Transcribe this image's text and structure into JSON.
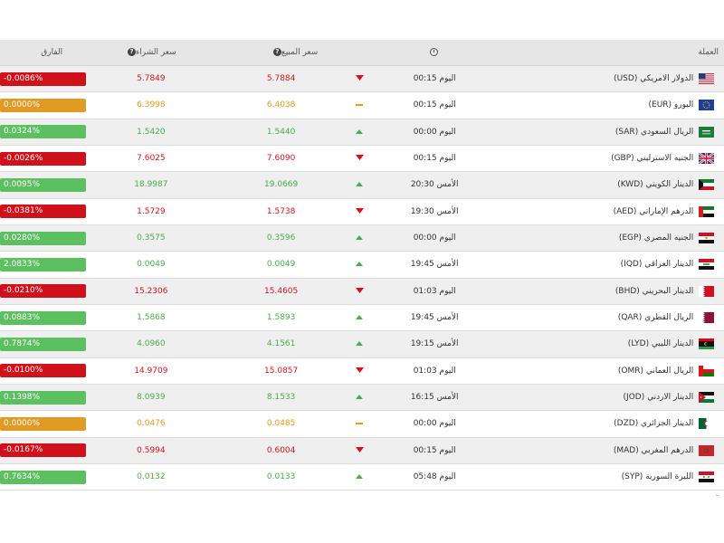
{
  "header": {
    "currency": "العملة",
    "sell_price": "سعر المبيع",
    "buy_price": "سعر الشراء",
    "difference": "الفارق",
    "time_icon": "clock-icon",
    "help_icon": "help-icon"
  },
  "colors": {
    "down": "#d0101a",
    "up": "#5cbf60",
    "flat": "#e19b25",
    "header_bg": "#e6e6e6"
  },
  "rows": [
    {
      "name": "الدولار الامريكي (USD)",
      "flag": "us",
      "time": "اليوم 00:15",
      "trend": "down",
      "sell": "5.7884",
      "buy": "5.7849",
      "diff": "-0.0086%"
    },
    {
      "name": "اليورو (EUR)",
      "flag": "eu",
      "time": "اليوم 00:15",
      "trend": "flat",
      "sell": "6.4038",
      "buy": "6.3998",
      "diff": "0.0000%"
    },
    {
      "name": "الريال السعودي (SAR)",
      "flag": "sa",
      "time": "اليوم 00:00",
      "trend": "up",
      "sell": "1.5440",
      "buy": "1.5420",
      "diff": "0.0324%"
    },
    {
      "name": "الجنيه الاسترليني (GBP)",
      "flag": "gb",
      "time": "اليوم 00:15",
      "trend": "down",
      "sell": "7.6090",
      "buy": "7.6025",
      "diff": "-0.0026%"
    },
    {
      "name": "الدينار الكويتي (KWD)",
      "flag": "kw",
      "time": "الأمس 20:30",
      "trend": "up",
      "sell": "19.0669",
      "buy": "18.9987",
      "diff": "0.0095%"
    },
    {
      "name": "الدرهم الإماراتي (AED)",
      "flag": "ae",
      "time": "الأمس 19:30",
      "trend": "down",
      "sell": "1.5738",
      "buy": "1.5729",
      "diff": "-0.0381%"
    },
    {
      "name": "الجنيه المصري (EGP)",
      "flag": "eg",
      "time": "اليوم 00:00",
      "trend": "up",
      "sell": "0.3596",
      "buy": "0.3575",
      "diff": "0.0280%"
    },
    {
      "name": "الدينار العراقي (IQD)",
      "flag": "iq",
      "time": "الأمس 19:45",
      "trend": "up",
      "sell": "0.0049",
      "buy": "0.0049",
      "diff": "2.0833%"
    },
    {
      "name": "الدينار البحريني (BHD)",
      "flag": "bh",
      "time": "اليوم 01:03",
      "trend": "down",
      "sell": "15.4605",
      "buy": "15.2306",
      "diff": "-0.0210%"
    },
    {
      "name": "الريال القطري (QAR)",
      "flag": "qa",
      "time": "الأمس 19:45",
      "trend": "up",
      "sell": "1.5893",
      "buy": "1.5868",
      "diff": "0.0883%"
    },
    {
      "name": "الدينار الليبي (LYD)",
      "flag": "ly",
      "time": "الأمس 19:15",
      "trend": "up",
      "sell": "4.1561",
      "buy": "4.0960",
      "diff": "0.7874%"
    },
    {
      "name": "الريال العماني (OMR)",
      "flag": "om",
      "time": "اليوم 01:03",
      "trend": "down",
      "sell": "15.0857",
      "buy": "14.9709",
      "diff": "-0.0100%"
    },
    {
      "name": "الدينار الاردني (JOD)",
      "flag": "jo",
      "time": "الأمس 16:15",
      "trend": "up",
      "sell": "8.1533",
      "buy": "8.0939",
      "diff": "0.1398%"
    },
    {
      "name": "الدينار الجزائري (DZD)",
      "flag": "dz",
      "time": "اليوم 00:00",
      "trend": "flat",
      "sell": "0.0485",
      "buy": "0.0476",
      "diff": "0.0000%"
    },
    {
      "name": "الدرهم المغربي (MAD)",
      "flag": "ma",
      "time": "اليوم 00:15",
      "trend": "down",
      "sell": "0.6004",
      "buy": "0.5994",
      "diff": "-0.0167%"
    },
    {
      "name": "الليرة السورية (SYP)",
      "flag": "sy",
      "time": "اليوم 05:48",
      "trend": "up",
      "sell": "0.0133",
      "buy": "0.0132",
      "diff": "0.7634%"
    }
  ]
}
